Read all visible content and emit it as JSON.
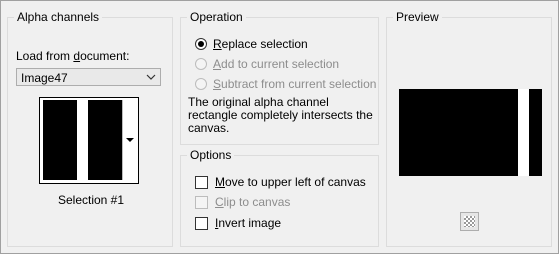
{
  "alpha_channels": {
    "title": "Alpha channels",
    "load_label_pre": "Load from ",
    "load_label_acc": "d",
    "load_label_post": "ocument:",
    "document_value": "Image47",
    "selection_label": "Selection #1"
  },
  "operation": {
    "title": "Operation",
    "options": [
      {
        "acc": "R",
        "rest": "eplace selection",
        "checked": true,
        "disabled": false
      },
      {
        "acc": "A",
        "rest": "dd to current selection",
        "checked": false,
        "disabled": true
      },
      {
        "acc": "S",
        "rest": "ubtract from current selection",
        "checked": false,
        "disabled": true
      }
    ],
    "description": "The original alpha channel rectangle completely intersects the canvas."
  },
  "options": {
    "title": "Options",
    "items": [
      {
        "acc": "M",
        "rest": "ove to upper left of canvas",
        "checked": false,
        "disabled": false
      },
      {
        "acc": "C",
        "rest": "lip to canvas",
        "checked": false,
        "disabled": true
      },
      {
        "acc": "I",
        "rest": "nvert image",
        "checked": false,
        "disabled": false
      }
    ]
  },
  "preview": {
    "title": "Preview",
    "background_toggle_icon": "checkerboard-icon"
  }
}
